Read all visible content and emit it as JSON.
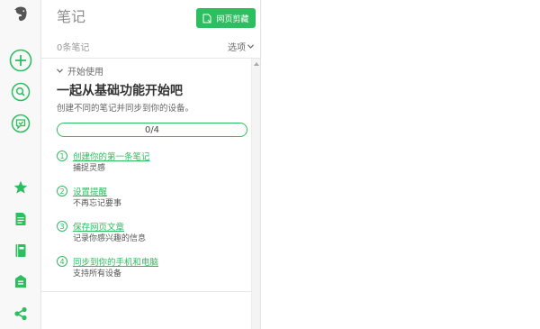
{
  "icons": {
    "logo": "evernote-elephant-icon",
    "new_note": "plus-circle-icon",
    "search": "search-icon",
    "work_chat": "work-chat-icon",
    "shortcuts": "star-icon",
    "notes": "notes-icon",
    "notebooks": "notebook-icon",
    "shared": "shared-icon",
    "explore": "share-network-icon"
  },
  "colors": {
    "accent": "#2dbe60",
    "rail_bg": "#f8f8f8"
  },
  "panel": {
    "title": "笔记",
    "clip_button": "网页剪藏",
    "note_count": "0条笔记",
    "options": "选项"
  },
  "getting_started": {
    "toggle_label": "开始使用",
    "heading": "一起从基础功能开始吧",
    "subheading": "创建不同的笔记并同步到你的设备。",
    "progress_text": "0/4",
    "progress_value": 0,
    "steps": [
      {
        "num": "1",
        "link": "创建你的第一条笔记",
        "desc": "捕捉灵感"
      },
      {
        "num": "2",
        "link": "设置提醒",
        "desc": "不再忘记要事"
      },
      {
        "num": "3",
        "link": "保存网页文章",
        "desc": "记录你感兴趣的信息"
      },
      {
        "num": "4",
        "link": "同步到你的手机和电脑",
        "desc": "支持所有设备"
      }
    ]
  }
}
